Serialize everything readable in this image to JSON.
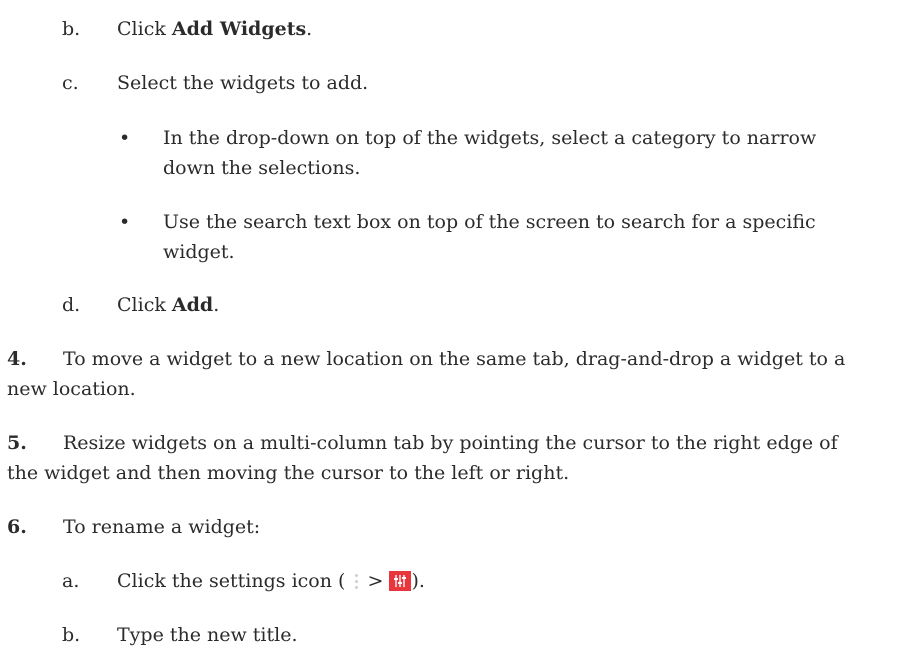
{
  "steps": {
    "b1": {
      "marker": "b.",
      "prefix": "Click ",
      "bold": "Add Widgets",
      "suffix": "."
    },
    "c": {
      "marker": "c.",
      "text": "Select the widgets to add."
    },
    "bullet1": {
      "marker": "•",
      "line1": "In the drop-down on top of the widgets, select a category to narrow",
      "line2": "down the selections."
    },
    "bullet2": {
      "marker": "•",
      "line1": "Use the search text box on top of the screen to search for a specific",
      "line2": "widget."
    },
    "d": {
      "marker": "d.",
      "prefix": "Click ",
      "bold": "Add",
      "suffix": "."
    },
    "step4": {
      "marker": "4.",
      "line1": "To move a widget to a new location on the same tab, drag-and-drop a widget to a",
      "line2": "new location."
    },
    "step5": {
      "marker": "5.",
      "line1": "Resize widgets on a multi-column tab by pointing the cursor to the right edge of",
      "line2": "the widget and then moving the cursor to the left or right."
    },
    "step6": {
      "marker": "6.",
      "text": "To rename a widget:"
    },
    "a": {
      "marker": "a.",
      "prefix": "Click the settings icon (",
      "separator": ">",
      "suffix": ")."
    },
    "b2": {
      "marker": "b.",
      "text": "Type the new title."
    }
  },
  "icons": {
    "kebab": "more-vertical-icon",
    "settings": "settings-sliders-icon",
    "settings_color": "#e8363d"
  }
}
